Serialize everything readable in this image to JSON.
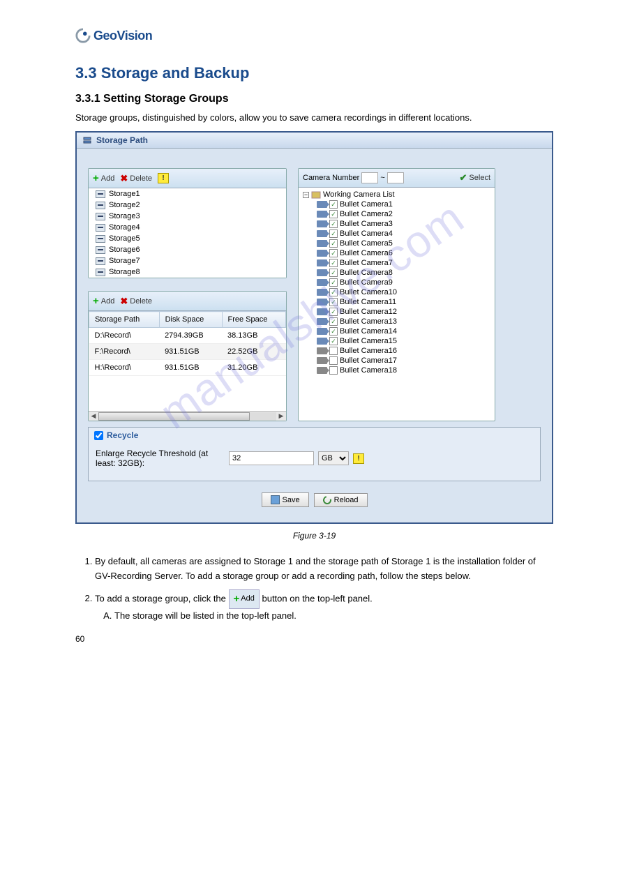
{
  "logo": {
    "brand": "Geo",
    "brand2": "Vision"
  },
  "heading": "3.3  Storage and Backup",
  "subheading": "3.3.1  Setting Storage Groups",
  "intro": "Storage groups, distinguished by colors, allow you to save camera recordings in different locations.",
  "window": {
    "title": "Storage Path",
    "storage_toolbar": {
      "add": "Add",
      "delete": "Delete"
    },
    "storages": [
      "Storage1",
      "Storage2",
      "Storage3",
      "Storage4",
      "Storage5",
      "Storage6",
      "Storage7",
      "Storage8"
    ],
    "path_toolbar": {
      "add": "Add",
      "delete": "Delete"
    },
    "path_headers": {
      "path": "Storage Path",
      "disk": "Disk Space",
      "free": "Free Space"
    },
    "paths": [
      {
        "path": "D:\\Record\\",
        "disk": "2794.39GB",
        "free": "38.13GB"
      },
      {
        "path": "F:\\Record\\",
        "disk": "931.51GB",
        "free": "22.52GB"
      },
      {
        "path": "H:\\Record\\",
        "disk": "931.51GB",
        "free": "31.20GB"
      }
    ],
    "camera_panel": {
      "label": "Camera Number",
      "to": "~",
      "select": "Select",
      "root": "Working Camera List"
    },
    "cameras": [
      {
        "name": "Bullet Camera1",
        "on": true
      },
      {
        "name": "Bullet Camera2",
        "on": true
      },
      {
        "name": "Bullet Camera3",
        "on": true
      },
      {
        "name": "Bullet Camera4",
        "on": true
      },
      {
        "name": "Bullet Camera5",
        "on": true
      },
      {
        "name": "Bullet Camera6",
        "on": true
      },
      {
        "name": "Bullet Camera7",
        "on": true
      },
      {
        "name": "Bullet Camera8",
        "on": true
      },
      {
        "name": "Bullet Camera9",
        "on": true
      },
      {
        "name": "Bullet Camera10",
        "on": true
      },
      {
        "name": "Bullet Camera11",
        "on": true
      },
      {
        "name": "Bullet Camera12",
        "on": true
      },
      {
        "name": "Bullet Camera13",
        "on": true
      },
      {
        "name": "Bullet Camera14",
        "on": true
      },
      {
        "name": "Bullet Camera15",
        "on": true
      },
      {
        "name": "Bullet Camera16",
        "on": false
      },
      {
        "name": "Bullet Camera17",
        "on": false
      },
      {
        "name": "Bullet Camera18",
        "on": false
      }
    ],
    "recycle": {
      "label": "Recycle",
      "threshold_label": "Enlarge Recycle Threshold (at least: 32GB):",
      "value": "32",
      "unit": "GB"
    },
    "buttons": {
      "save": "Save",
      "reload": "Reload"
    }
  },
  "caption": "Figure 3-19",
  "step1": "By default, all cameras are assigned to Storage 1 and the storage path of Storage 1 is the installation folder of GV-Recording Server. To add a storage group or add a recording path, follow the steps below.",
  "step2_lead": "To add a storage group, click the ",
  "inline_add": "Add",
  "step2_tail": " button on the top-left panel.",
  "stepA": "The storage will be listed in the top-left panel.",
  "watermark": "manualshive.com",
  "pagenum": "60"
}
